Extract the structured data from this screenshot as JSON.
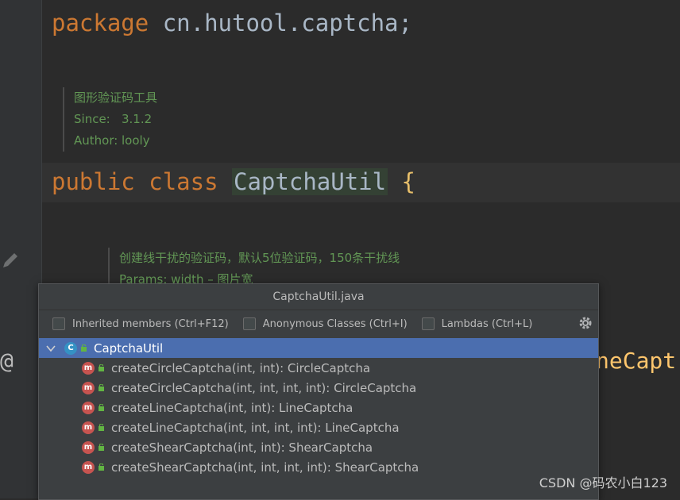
{
  "editor": {
    "package_kw": "package",
    "package_name": "cn.hutool.captcha;",
    "class_doc": {
      "description": "图形验证码工具",
      "since_label": "Since:",
      "since_value": "3.1.2",
      "author_label": "Author:",
      "author_value": "looly"
    },
    "class_kw1": "public",
    "class_kw2": "class",
    "class_name": "CaptchaUtil",
    "open_brace": "{",
    "method_doc": {
      "description": "创建线干扰的验证码，默认5位验证码，150条干扰线",
      "params_partial": "Params: width – 图片宽"
    },
    "annotation_symbol": "@",
    "right_fragment": "neCapt"
  },
  "popup": {
    "title": "CaptchaUtil.java",
    "options": [
      {
        "label": "Inherited members (Ctrl+F12)",
        "checked": false
      },
      {
        "label": "Anonymous Classes (Ctrl+I)",
        "checked": false
      },
      {
        "label": "Lambdas (Ctrl+L)",
        "checked": false
      }
    ],
    "root": {
      "icon_letter": "C",
      "label": "CaptchaUtil"
    },
    "methods": [
      {
        "icon_letter": "m",
        "label": "createCircleCaptcha(int, int): CircleCaptcha"
      },
      {
        "icon_letter": "m",
        "label": "createCircleCaptcha(int, int, int, int): CircleCaptcha"
      },
      {
        "icon_letter": "m",
        "label": "createLineCaptcha(int, int): LineCaptcha"
      },
      {
        "icon_letter": "m",
        "label": "createLineCaptcha(int, int, int, int): LineCaptcha"
      },
      {
        "icon_letter": "m",
        "label": "createShearCaptcha(int, int): ShearCaptcha"
      },
      {
        "icon_letter": "m",
        "label": "createShearCaptcha(int, int, int, int): ShearCaptcha"
      }
    ]
  },
  "watermark": "CSDN @码农小白123",
  "colors": {
    "keyword": "#cc7832",
    "doc_comment": "#629755",
    "selection": "#4b6eaf",
    "method_icon": "#c75450",
    "class_icon": "#3592c4"
  }
}
